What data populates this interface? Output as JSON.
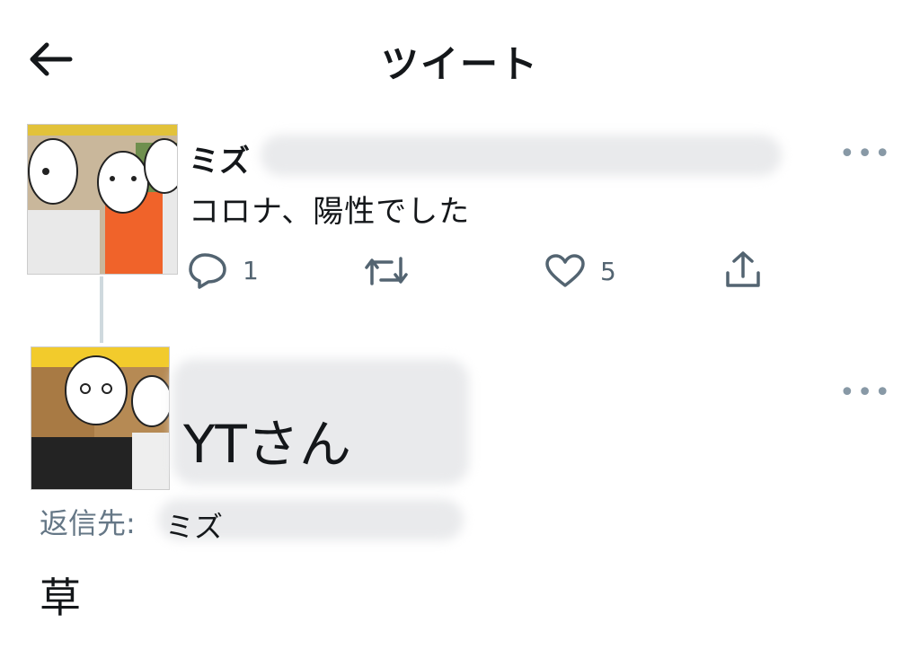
{
  "header": {
    "title": "ツイート"
  },
  "original_tweet": {
    "author": "ミズ",
    "text": "コロナ、陽性でした",
    "reply_count": "1",
    "like_count": "5"
  },
  "reply_tweet": {
    "author": "YTさん",
    "reply_to_label": "返信先:",
    "reply_to_name": "ミズ",
    "text": "草"
  },
  "icons": [
    "back-arrow-icon",
    "more-icon",
    "reply-icon",
    "retweet-icon",
    "like-icon",
    "share-icon"
  ],
  "colors": {
    "icon": "#536471",
    "muted": "#657786",
    "thread_line": "#cfd9de"
  }
}
